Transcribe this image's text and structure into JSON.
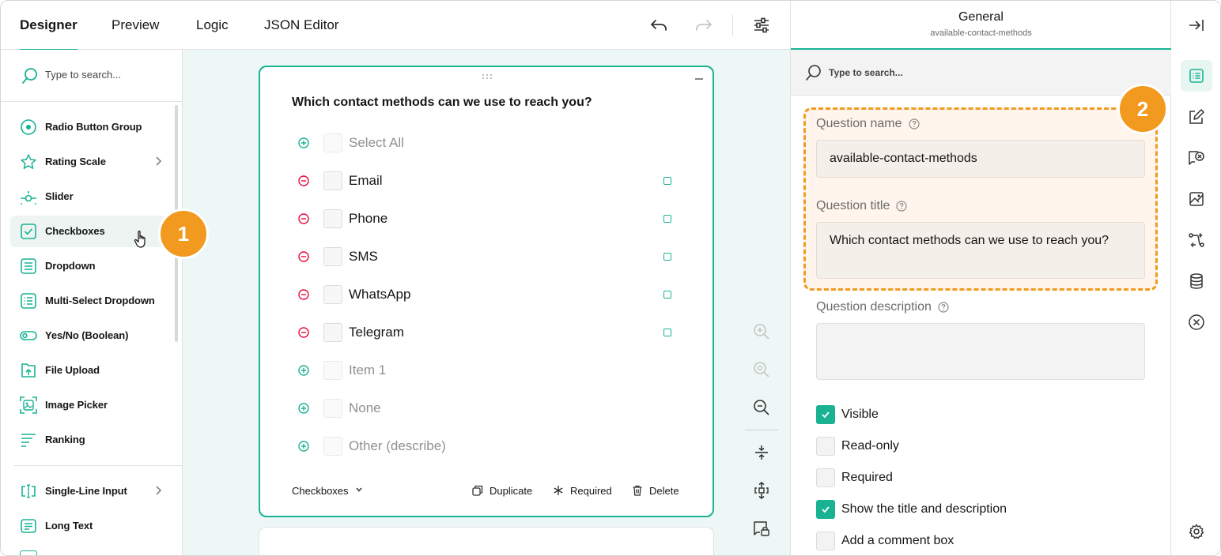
{
  "tabs": [
    {
      "label": "Designer",
      "active": true
    },
    {
      "label": "Preview",
      "active": false
    },
    {
      "label": "Logic",
      "active": false
    },
    {
      "label": "JSON Editor",
      "active": false
    }
  ],
  "toolbox": {
    "search_placeholder": "Type to search...",
    "items": [
      {
        "label": "Radio Button Group",
        "icon": "radio-icon"
      },
      {
        "label": "Rating Scale",
        "icon": "star-icon",
        "has_submenu": true
      },
      {
        "label": "Slider",
        "icon": "slider-icon"
      },
      {
        "label": "Checkboxes",
        "icon": "checkbox-icon",
        "hovered": true
      },
      {
        "label": "Dropdown",
        "icon": "dropdown-icon"
      },
      {
        "label": "Multi-Select Dropdown",
        "icon": "multiselect-icon"
      },
      {
        "label": "Yes/No (Boolean)",
        "icon": "toggle-icon"
      },
      {
        "label": "File Upload",
        "icon": "file-upload-icon"
      },
      {
        "label": "Image Picker",
        "icon": "image-picker-icon"
      },
      {
        "label": "Ranking",
        "icon": "ranking-icon"
      },
      {
        "label": "Single-Line Input",
        "icon": "text-input-icon",
        "has_submenu": true
      },
      {
        "label": "Long Text",
        "icon": "long-text-icon"
      }
    ]
  },
  "question": {
    "title": "Which contact methods can we use to reach you?",
    "choices": [
      {
        "label": "Select All",
        "kind": "add"
      },
      {
        "label": "Email",
        "kind": "remove"
      },
      {
        "label": "Phone",
        "kind": "remove"
      },
      {
        "label": "SMS",
        "kind": "remove"
      },
      {
        "label": "WhatsApp",
        "kind": "remove"
      },
      {
        "label": "Telegram",
        "kind": "remove"
      },
      {
        "label": "Item 1",
        "kind": "add"
      },
      {
        "label": "None",
        "kind": "add"
      },
      {
        "label": "Other (describe)",
        "kind": "add"
      }
    ],
    "type_label": "Checkboxes",
    "actions": {
      "duplicate": "Duplicate",
      "required": "Required",
      "delete": "Delete"
    }
  },
  "properties": {
    "header_title": "General",
    "header_subtitle": "available-contact-methods",
    "search_placeholder": "Type to search...",
    "name_label": "Question name",
    "name_value": "available-contact-methods",
    "title_label": "Question title",
    "title_value": "Which contact methods can we use to reach you?",
    "description_label": "Question description",
    "description_value": "",
    "checkboxes": [
      {
        "label": "Visible",
        "checked": true
      },
      {
        "label": "Read-only",
        "checked": false
      },
      {
        "label": "Required",
        "checked": false
      },
      {
        "label": "Show the title and description",
        "checked": true
      },
      {
        "label": "Add a comment box",
        "checked": false
      }
    ]
  },
  "callouts": [
    "1",
    "2"
  ],
  "colors": {
    "accent": "#19b394",
    "callout": "#f29a1f",
    "remove": "#e50a3e",
    "canvas": "#edf7f5"
  }
}
